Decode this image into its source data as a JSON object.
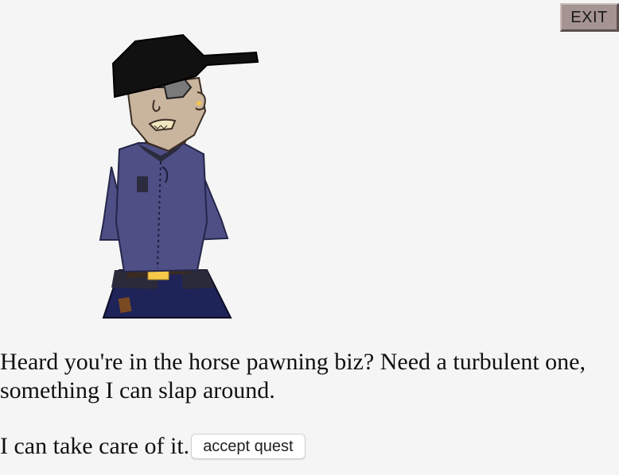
{
  "controls": {
    "exit_label": "EXIT"
  },
  "npc": {
    "portrait_icon": "npc-character-sprite"
  },
  "dialogue": {
    "text": "Heard you're in the horse pawning biz? Need a turbulent one, something I can slap around."
  },
  "response": {
    "text": "I can take care of it.",
    "accept_label": "accept quest"
  },
  "colors": {
    "background": "#f5f5f5",
    "exit_button": "#a59492",
    "jacket": "#4e4f85",
    "pants": "#1f2458",
    "hat": "#111111",
    "skin": "#c9b49e",
    "belt_buckle": "#f5c84a"
  }
}
